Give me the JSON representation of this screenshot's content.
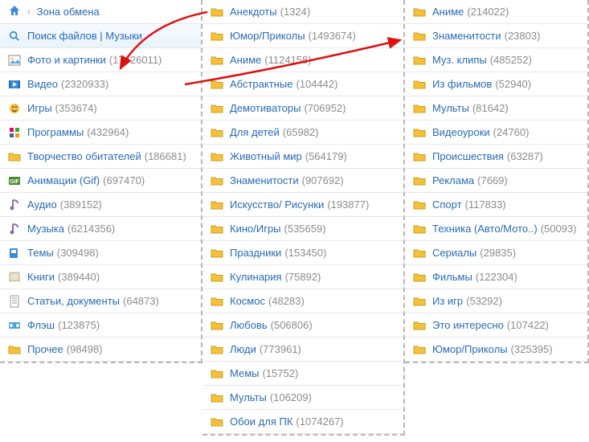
{
  "breadcrumb": {
    "section": "Зона обмена"
  },
  "col1": {
    "search_label": "Поиск файлов | Музыки",
    "items": [
      {
        "icon": "photo",
        "label": "Фото и картинки",
        "count": "17426011"
      },
      {
        "icon": "video",
        "label": "Видео",
        "count": "2320933"
      },
      {
        "icon": "games",
        "label": "Игры",
        "count": "353674"
      },
      {
        "icon": "apps",
        "label": "Программы",
        "count": "432964"
      },
      {
        "icon": "folder",
        "label": "Творчество обитателей",
        "count": "186681"
      },
      {
        "icon": "gif",
        "label": "Анимации (Gif)",
        "count": "697470"
      },
      {
        "icon": "audio",
        "label": "Аудио",
        "count": "389152"
      },
      {
        "icon": "audio",
        "label": "Музыка",
        "count": "6214356"
      },
      {
        "icon": "theme",
        "label": "Темы",
        "count": "309498"
      },
      {
        "icon": "book",
        "label": "Книги",
        "count": "389440"
      },
      {
        "icon": "doc",
        "label": "Статьи, документы",
        "count": "64873"
      },
      {
        "icon": "flash",
        "label": "Флэш",
        "count": "123875"
      },
      {
        "icon": "folder",
        "label": "Прочее",
        "count": "98498"
      }
    ]
  },
  "col2": {
    "items": [
      {
        "label": "Анекдоты",
        "count": "1324"
      },
      {
        "label": "Юмор/Приколы",
        "count": "1493674"
      },
      {
        "label": "Аниме",
        "count": "1124158"
      },
      {
        "label": "Абстрактные",
        "count": "104442"
      },
      {
        "label": "Демотиваторы",
        "count": "706952"
      },
      {
        "label": "Для детей",
        "count": "65982"
      },
      {
        "label": "Животный мир",
        "count": "564179"
      },
      {
        "label": "Знаменитости",
        "count": "907692"
      },
      {
        "label": "Искусство/ Рисунки",
        "count": "193877"
      },
      {
        "label": "Кино/Игры",
        "count": "535659"
      },
      {
        "label": "Праздники",
        "count": "153450"
      },
      {
        "label": "Кулинария",
        "count": "75892"
      },
      {
        "label": "Космос",
        "count": "48283"
      },
      {
        "label": "Любовь",
        "count": "506806"
      },
      {
        "label": "Люди",
        "count": "773961"
      },
      {
        "label": "Мемы",
        "count": "15752"
      },
      {
        "label": "Мульты",
        "count": "106209"
      },
      {
        "label": "Обои для ПК",
        "count": "1074267"
      }
    ]
  },
  "col3": {
    "items": [
      {
        "label": "Аниме",
        "count": "214022"
      },
      {
        "label": "Знаменитости",
        "count": "23803"
      },
      {
        "label": "Муз. клипы",
        "count": "485252"
      },
      {
        "label": "Из фильмов",
        "count": "52940"
      },
      {
        "label": "Мульты",
        "count": "81642"
      },
      {
        "label": "Видеоуроки",
        "count": "24760"
      },
      {
        "label": "Происшествия",
        "count": "63287"
      },
      {
        "label": "Реклама",
        "count": "7669"
      },
      {
        "label": "Спорт",
        "count": "117833"
      },
      {
        "label": "Техника (Авто/Мото..)",
        "count": "50093"
      },
      {
        "label": "Сериалы",
        "count": "29835"
      },
      {
        "label": "Фильмы",
        "count": "122304"
      },
      {
        "label": "Из игр",
        "count": "53292"
      },
      {
        "label": "Это интересно",
        "count": "107422"
      },
      {
        "label": "Юмор/Приколы",
        "count": "325395"
      }
    ]
  }
}
